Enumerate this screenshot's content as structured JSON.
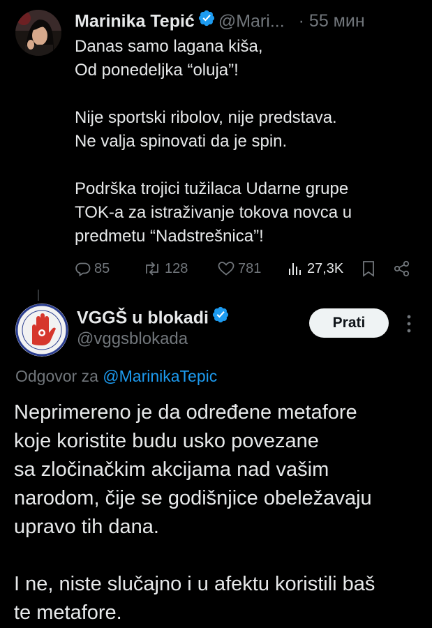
{
  "tweet1": {
    "author_name": "Marinika Tepić",
    "handle": "@Mari...",
    "time": "· 55 мин",
    "lines": [
      "Danas samo lagana kiša,",
      "Od ponedeljka “oluja”!",
      "",
      "Nije sportski ribolov, nije predstava.",
      "Ne valja spinovati da je spin.",
      "",
      "Podrška trojici tužilaca Udarne grupe",
      "TOK-a za istraživanje tokova novca u",
      "predmetu “Nadstrešnica”!"
    ],
    "replies": "85",
    "reposts": "128",
    "likes": "781",
    "views": "27,3K"
  },
  "tweet2": {
    "author_name": "VGGŠ u blokadi",
    "handle": "@vggsblokada",
    "follow_label": "Prati",
    "reply_prefix": "Odgovor za",
    "reply_mention": "@MarinikaTepic",
    "lines": [
      "Neprimereno je da određene metafore",
      "koje koristite budu usko povezane",
      "sa zločinačkim akcijama nad vašim",
      "narodom, čije se godišnjice obeležavaju",
      "upravo tih dana.",
      "",
      "I ne, niste slučajno i u afektu koristili baš",
      "te metafore."
    ]
  },
  "icons": {
    "verified": "verified-badge-icon",
    "reply": "reply-icon",
    "repost": "repost-icon",
    "like": "heart-icon",
    "views": "views-icon",
    "bookmark": "bookmark-icon",
    "share": "share-icon",
    "more": "more-vertical-icon"
  },
  "colors": {
    "background": "#000000",
    "text": "#e7e9ea",
    "muted": "#71767b",
    "accent": "#1d9bf0",
    "follow_button_bg": "#eff3f4"
  }
}
